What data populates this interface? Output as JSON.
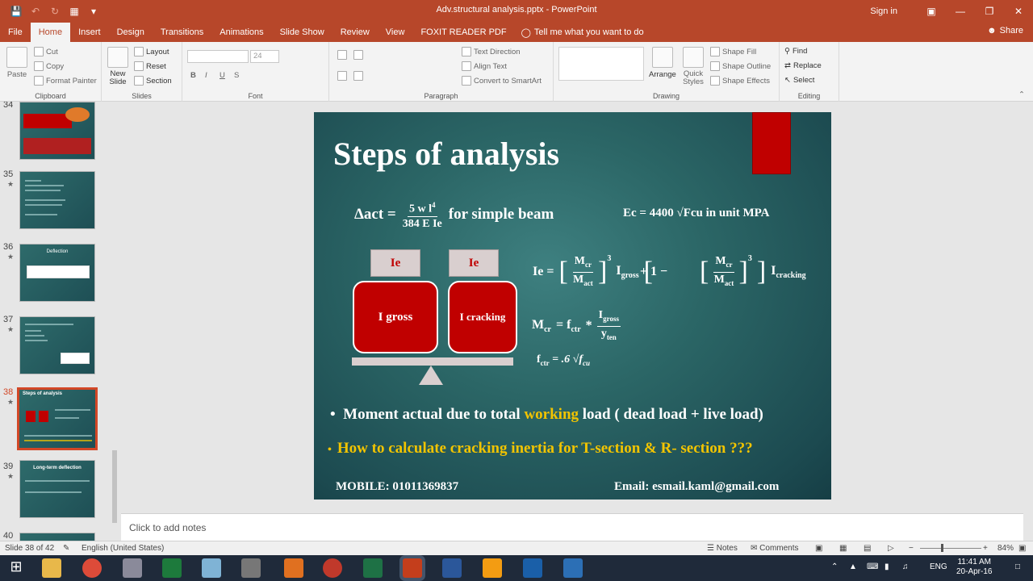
{
  "window": {
    "title": "Adv.structural analysis.pptx - PowerPoint",
    "sign_in": "Sign in",
    "share": "Share"
  },
  "tabs": [
    "File",
    "Home",
    "Insert",
    "Design",
    "Transitions",
    "Animations",
    "Slide Show",
    "Review",
    "View",
    "FOXIT READER PDF"
  ],
  "tell_me": "Tell me what you want to do",
  "ribbon": {
    "clipboard": {
      "label": "Clipboard",
      "paste": "Paste",
      "cut": "Cut",
      "copy": "Copy",
      "format_painter": "Format Painter"
    },
    "slides": {
      "label": "Slides",
      "new_slide": "New Slide",
      "layout": "Layout",
      "reset": "Reset",
      "section": "Section"
    },
    "font": {
      "label": "Font",
      "size": "24"
    },
    "paragraph": {
      "label": "Paragraph",
      "text_direction": "Text Direction",
      "align_text": "Align Text",
      "smartart": "Convert to SmartArt"
    },
    "drawing": {
      "label": "Drawing",
      "arrange": "Arrange",
      "quick_styles": "Quick Styles",
      "shape_fill": "Shape Fill",
      "shape_outline": "Shape Outline",
      "shape_effects": "Shape Effects"
    },
    "editing": {
      "label": "Editing",
      "find": "Find",
      "replace": "Replace",
      "select": "Select"
    }
  },
  "thumbnails": [
    {
      "num": "34"
    },
    {
      "num": "35",
      "title": ""
    },
    {
      "num": "36",
      "title": "Deflection"
    },
    {
      "num": "37",
      "title": ""
    },
    {
      "num": "38",
      "title": "Steps of analysis"
    },
    {
      "num": "39",
      "title": "Long-term deflection"
    },
    {
      "num": "40"
    }
  ],
  "slide": {
    "title": "Steps of analysis",
    "delta": "Δact =",
    "frac_num": "5 w l",
    "frac_num_sup": "4",
    "frac_den": "384 E Ie",
    "simple_beam": "for simple beam",
    "ec_formula": "Ec = 4400 √Fcu  in unit MPA",
    "ie1": "Ie",
    "ie2": "Ie",
    "igross": "I gross",
    "icracking": "I cracking",
    "ie_eq": "Ie =",
    "mcr": "M",
    "mcr_sub": "cr",
    "mact": "M",
    "mact_sub": "act",
    "cube": "3",
    "igross_term": "I",
    "igross_sub": "gross",
    "plus_one_minus": "+  1 −",
    "icr_term": "I",
    "icr_sub": "cracking",
    "mcr_eq": "= f",
    "ctr_sub": "ctr",
    "times": "*",
    "ygross": "I",
    "ygross_sub": "gross",
    "yten": "y",
    "yten_sub": "ten",
    "fctr": "f",
    "fctr_rhs": "= .6 √f",
    "fcu_sub": "cu",
    "bullet1_a": "Moment actual due to total ",
    "bullet1_b": "working",
    "bullet1_c": " load ( dead load + live load)",
    "bullet2": "How to calculate cracking inertia for T-section & R- section ???",
    "mobile": "MOBILE: 01011369837",
    "email": "Email: esmail.kaml@gmail.com"
  },
  "notes_placeholder": "Click to add notes",
  "status": {
    "slide_of": "Slide 38 of 42",
    "language": "English (United States)",
    "notes": "Notes",
    "comments": "Comments",
    "zoom": "84%"
  },
  "taskbar": {
    "lang": "ENG",
    "time": "11:41 AM",
    "date": "20-Apr-16"
  }
}
